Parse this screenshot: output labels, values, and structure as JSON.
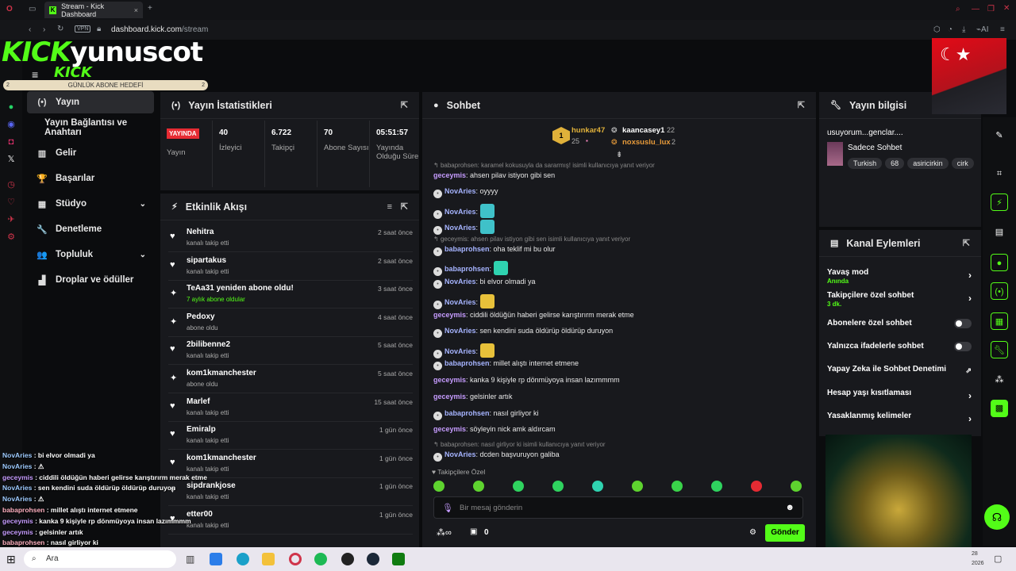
{
  "browser": {
    "tab_title": "Stream - Kick Dashboard",
    "url_domain": "dashboard.kick.com",
    "url_path": "/stream",
    "vpn": "VPN",
    "ai": "AI"
  },
  "overlay": {
    "logo_kick": "KICK",
    "logo_name": "yunuscot",
    "logo_kick2": "KICK",
    "goal_label": "GÜNLÜK ABONE HEDEFİ",
    "goal_left": "2",
    "goal_right": "2"
  },
  "sidebar": {
    "items": [
      {
        "label": "Yayın",
        "icon": "(•)"
      },
      {
        "label": "Yayın Bağlantısı ve Anahtarı",
        "icon": ""
      },
      {
        "label": "Gelir",
        "icon": "▥"
      },
      {
        "label": "Başarılar",
        "icon": "🏆"
      },
      {
        "label": "Stüdyo",
        "icon": "▦"
      },
      {
        "label": "Denetleme",
        "icon": "🔧"
      },
      {
        "label": "Topluluk",
        "icon": "👥"
      },
      {
        "label": "Droplar ve ödüller",
        "icon": "▟"
      }
    ]
  },
  "stats": {
    "title": "Yayın İstatistikleri",
    "live_badge": "YAYINDA",
    "live_label": "Yayın",
    "viewers_value": "40",
    "viewers_label": "İzleyici",
    "followers_value": "6.722",
    "followers_label": "Takipçi",
    "subs_value": "70",
    "subs_label": "Abone Sayısı",
    "uptime_value": "05:51:57",
    "uptime_label": "Yayında Olduğu Süre"
  },
  "activity": {
    "title": "Etkinlik Akışı",
    "events": [
      {
        "name": "Nehitra",
        "sub": "kanalı takip etti",
        "time": "2 saat önce",
        "icon": "♥"
      },
      {
        "name": "sipartakus",
        "sub": "kanalı takip etti",
        "time": "2 saat önce",
        "icon": "♥"
      },
      {
        "name": "TeAa31 yeniden abone oldu!",
        "sub": "7 aylık abone oldular",
        "time": "3 saat önce",
        "icon": "✦"
      },
      {
        "name": "Pedoxy",
        "sub": "abone oldu",
        "time": "4 saat önce",
        "icon": "✦"
      },
      {
        "name": "2bilibenne2",
        "sub": "kanalı takip etti",
        "time": "5 saat önce",
        "icon": "♥"
      },
      {
        "name": "kom1kmanchester",
        "sub": "abone oldu",
        "time": "5 saat önce",
        "icon": "✦"
      },
      {
        "name": "Marlef",
        "sub": "kanalı takip etti",
        "time": "15 saat önce",
        "icon": "♥"
      },
      {
        "name": "Emiralp",
        "sub": "kanalı takip etti",
        "time": "1 gün önce",
        "icon": "♥"
      },
      {
        "name": "kom1kmanchester",
        "sub": "kanalı takip etti",
        "time": "1 gün önce",
        "icon": "♥"
      },
      {
        "name": "sipdrankjose",
        "sub": "kanalı takip etti",
        "time": "1 gün önce",
        "icon": "♥"
      },
      {
        "name": "etter00",
        "sub": "kanalı takip etti",
        "time": "1 gün önce",
        "icon": "♥"
      }
    ]
  },
  "chat": {
    "title": "Sohbet",
    "top1_rank": "1",
    "top1_name": "hunkar47",
    "top1_count": "25",
    "top2_name": "kaancasey1",
    "top2_count": "22",
    "top3_name": "noxsuslu_lux",
    "top3_count": "2",
    "messages": [
      {
        "type": "reply",
        "text": "babaprohsen: karamel kokusuyla da sararmış! isimli kullanıcıya yanıt veriyor"
      },
      {
        "type": "msg",
        "user": "geceymis",
        "cls": "u-gec",
        "text": ": ahsen pilav istiyon gibi sen",
        "av": false
      },
      {
        "type": "msg",
        "user": "NovAries",
        "cls": "u-nov",
        "text": ": oyyyy",
        "av": true
      },
      {
        "type": "msg",
        "user": "NovAries",
        "cls": "u-nov",
        "text": ":",
        "av": true,
        "emote": "#3fc1c9"
      },
      {
        "type": "msg",
        "user": "NovAries",
        "cls": "u-nov",
        "text": ":",
        "av": true,
        "emote": "#3fc1c9"
      },
      {
        "type": "reply",
        "text": "geceymis: ahsen pilav istiyon gibi sen isimli kullanıcıya yanıt veriyor"
      },
      {
        "type": "msg",
        "user": "babaprohsen",
        "cls": "u-bab",
        "text": ": oha teklif mi bu olur",
        "av": true
      },
      {
        "type": "msg",
        "user": "babaprohsen",
        "cls": "u-bab",
        "text": ":",
        "av": true,
        "emote": "#2fd3b0"
      },
      {
        "type": "msg",
        "user": "NovAries",
        "cls": "u-nov",
        "text": ": bi elvor olmadi ya",
        "av": true
      },
      {
        "type": "msg",
        "user": "NovAries",
        "cls": "u-nov",
        "text": ":",
        "av": true,
        "emote": "#e8c13a"
      },
      {
        "type": "msg",
        "user": "geceymis",
        "cls": "u-gec",
        "text": ": ciddili öldüğün haberi gelirse karıştırırm merak etme",
        "av": false
      },
      {
        "type": "msg",
        "user": "NovAries",
        "cls": "u-nov",
        "text": ": sen kendini suda öldürüp öldürüp duruyon",
        "av": true
      },
      {
        "type": "msg",
        "user": "NovAries",
        "cls": "u-nov",
        "text": ":",
        "av": true,
        "emote": "#e8c13a"
      },
      {
        "type": "msg",
        "user": "babaprohsen",
        "cls": "u-bab",
        "text": ": millet alıştı internet etmene",
        "av": true
      },
      {
        "type": "msg",
        "user": "geceymis",
        "cls": "u-gec",
        "text": ": kanka 9 kişiyle rp dönmüyoya insan lazımmmm",
        "av": false
      },
      {
        "type": "msg",
        "user": "geceymis",
        "cls": "u-gec",
        "text": ": gelsinler artık",
        "av": false
      },
      {
        "type": "msg",
        "user": "babaprohsen",
        "cls": "u-bab",
        "text": ": nasıl girliyor ki",
        "av": true
      },
      {
        "type": "msg",
        "user": "geceymis",
        "cls": "u-gec",
        "text": ": söyleyin nick amk aldırcam",
        "av": false
      },
      {
        "type": "reply",
        "text": "babaprohsen: nasıl girliyor ki isimli kullanıcıya yanıt veriyor"
      },
      {
        "type": "msg",
        "user": "NovAries",
        "cls": "u-nov",
        "text": ": dcden başvuruyon galiba",
        "av": true
      }
    ],
    "followers_only": "Takipçilere Özel",
    "input_placeholder": "Bir mesaj gönderin",
    "points": "0",
    "send": "Gönder"
  },
  "info": {
    "title": "Yayın bilgisi",
    "stream_title": "usuyorum...genclar....",
    "category": "Sadece Sohbet",
    "tags": [
      "Turkish",
      "68",
      "asiricirkin",
      "cirk"
    ]
  },
  "actions": {
    "title": "Kanal Eylemleri",
    "slow_mode": "Yavaş mod",
    "slow_mode_sub": "Anında",
    "followers_chat": "Takipçilere özel sohbet",
    "followers_chat_sub": "3 dk.",
    "subs_chat": "Abonelere özel sohbet",
    "emote_chat": "Yalnızca ifadelerle sohbet",
    "ai_mod": "Yapay Zeka ile Sohbet Denetimi",
    "age_restrict": "Hesap yaşı kısıtlaması",
    "banned_words": "Yasaklanmış kelimeler"
  },
  "overlay_chat": [
    {
      "user": "NovAries",
      "text": " : bi elvor olmadi ya",
      "color": "#9ecbff"
    },
    {
      "user": "NovAries",
      "text": " : ⚠",
      "color": "#9ecbff"
    },
    {
      "user": "geceymis",
      "text": " : ciddili öldüğün haberi gelirse karıştırırm merak etme",
      "color": "#c69cff"
    },
    {
      "user": "NovAries",
      "text": " : sen kendini suda öldürüp öldürüp duruyon",
      "color": "#9ecbff"
    },
    {
      "user": "NovAries",
      "text": " : ⚠",
      "color": "#9ecbff"
    },
    {
      "user": "babaprohsen",
      "text": " : millet alıştı internet etmene",
      "color": "#ffb0c0"
    },
    {
      "user": "geceymis",
      "text": " : kanka 9 kişiyle rp dönmüyoya insan lazımmmm",
      "color": "#c69cff"
    },
    {
      "user": "geceymis",
      "text": " : gelsinler artık",
      "color": "#c69cff"
    },
    {
      "user": "babaprohsen",
      "text": " : nasıl girliyor ki",
      "color": "#ffb0c0"
    }
  ],
  "taskbar": {
    "search": "Ara",
    "date_top": "28",
    "date_bottom": "2026"
  },
  "colors": {
    "brand": "#53fc18",
    "live": "#e62b33",
    "panel": "#18191d"
  }
}
